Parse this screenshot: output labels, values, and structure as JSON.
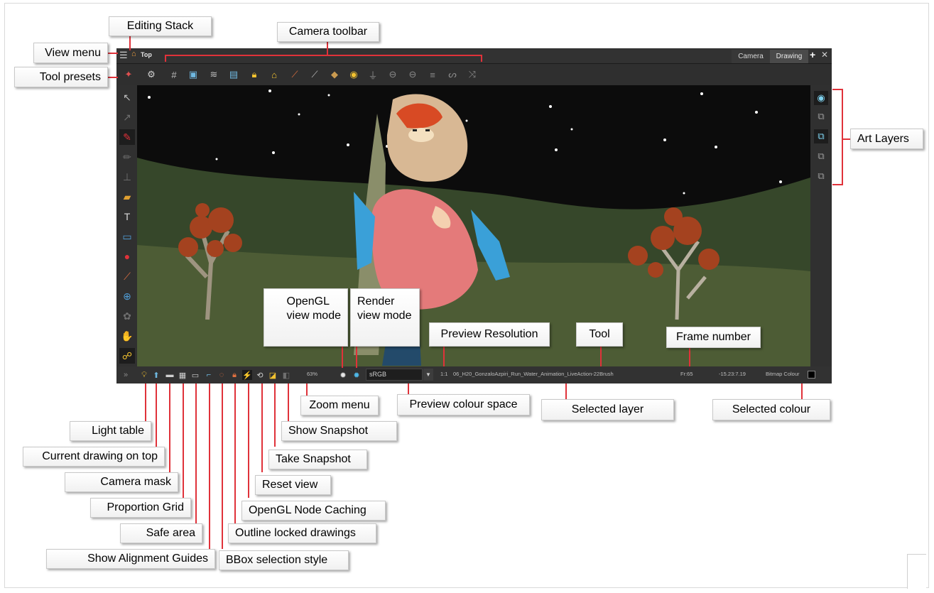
{
  "app": {
    "stack_label": "Top",
    "tabs": [
      {
        "label": "Camera"
      },
      {
        "label": "Drawing"
      }
    ],
    "bottom": {
      "zoom": "63%",
      "colorspace": "sRGB",
      "resolution": "1:1",
      "layer": "06_H20_GonzaloAzpiri_Run_Water_Animation_LiveAction-22Brush",
      "frame": "Fr:65",
      "coords": "-15.23:7.19",
      "color_label": "Bitmap Colour",
      "selected_color": "#000000"
    }
  },
  "callouts": {
    "editing_stack": "Editing Stack",
    "camera_toolbar": "Camera toolbar",
    "view_menu": "View menu",
    "tool_presets": "Tool presets",
    "art_layers": "Art Layers",
    "opengl_view_mode": "OpenGL\nview mode",
    "render_view_mode": "Render\nview mode",
    "preview_resolution": "Preview Resolution",
    "tool": "Tool",
    "frame_number": "Frame number",
    "zoom_menu": "Zoom menu",
    "preview_colour_space": "Preview colour space",
    "selected_layer": "Selected layer",
    "selected_colour": "Selected colour",
    "show_snapshot": "Show Snapshot",
    "light_table": "Light table",
    "current_drawing_on_top": "Current drawing on top",
    "take_snapshot": "Take Snapshot",
    "camera_mask": "Camera mask",
    "reset_view": "Reset view",
    "proportion_grid": "Proportion Grid",
    "opengl_node_caching": "OpenGL Node Caching",
    "safe_area": "Safe area",
    "outline_locked_drawings": "Outline locked drawings",
    "show_alignment_guides": "Show Alignment Guides",
    "bbox_selection_style": "BBox selection style"
  },
  "colors": {
    "leader": "#e0323a",
    "sky": "#0c0c0c",
    "hill": "#36472a",
    "ground": "#4d5c35",
    "foliage": "#a4421f"
  }
}
